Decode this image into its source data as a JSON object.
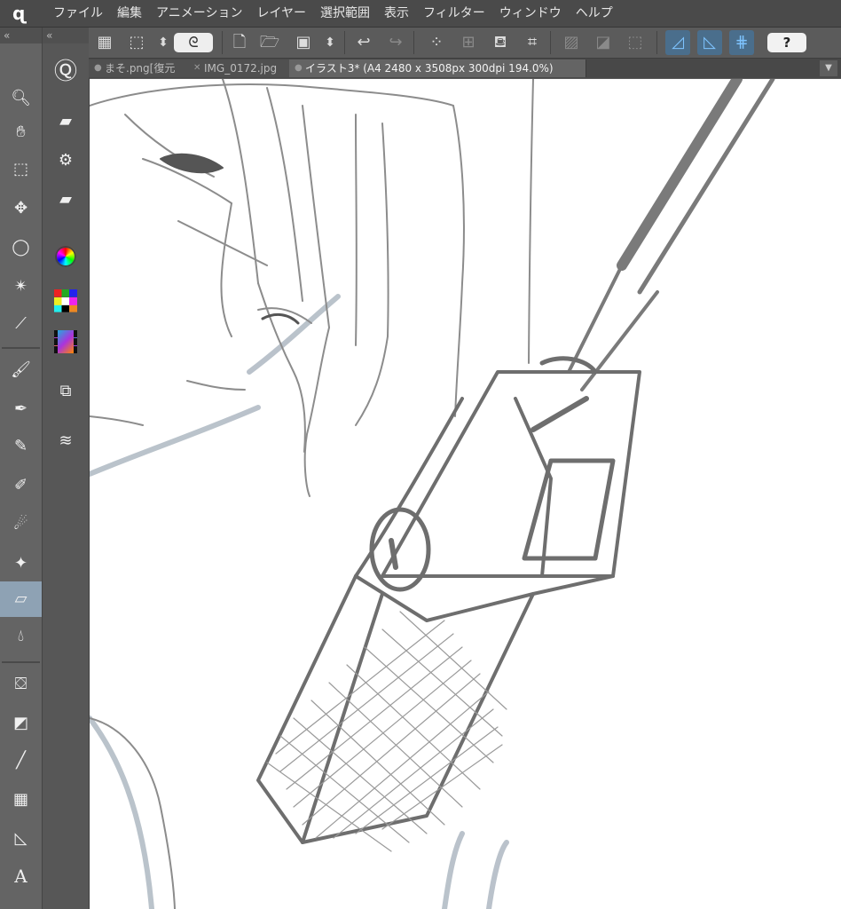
{
  "app": {
    "logo_glyph": "ɋ"
  },
  "menu": [
    "ファイル",
    "編集",
    "アニメーション",
    "レイヤー",
    "選択範囲",
    "表示",
    "フィルター",
    "ウィンドウ",
    "ヘルプ"
  ],
  "toolbar": {
    "icons": [
      "grid-icon",
      "selection-icon",
      "up-down-stepper-icon",
      "lasso-icon",
      "new-file-icon",
      "open-file-icon",
      "save-icon",
      "up-down-stepper-icon",
      "undo-icon",
      "redo-icon",
      "sparkle-icon",
      "transform-icon",
      "fill-icon",
      "crop-icon",
      "clear-icon",
      "invert-icon",
      "select-all-icon",
      "ruler-snap-icon",
      "special-ruler-snap-icon",
      "grid-snap-icon"
    ],
    "help_label": "?"
  },
  "tabs": [
    {
      "label": "まそ.png[復元",
      "active": false,
      "mark": "●"
    },
    {
      "label": "IMG_0172.jpg",
      "active": false,
      "mark": "✕"
    },
    {
      "label": "イラスト3* (A4 2480 x 3508px 300dpi 194.0%)",
      "active": true,
      "mark": "●"
    }
  ],
  "tool_panel": {
    "collapse_label": "«",
    "tools": [
      "zoom-icon",
      "hand-icon",
      "object-icon",
      "operation-icon",
      "lasso-selection-icon",
      "magic-wand-icon",
      "eyedropper-icon",
      "brush-icon",
      "pen-icon",
      "pencil-icon",
      "marker-icon",
      "airbrush-icon",
      "decoration-icon",
      "eraser-icon",
      "blend-icon",
      "fill-bucket-icon",
      "gradient-icon",
      "line-icon",
      "frame-icon",
      "ruler-icon",
      "text-icon"
    ],
    "selected": "eraser-icon",
    "text_tool_glyph": "A"
  },
  "sub_panel": {
    "collapse_label": "«",
    "items": [
      "quick-access-icon",
      "tool-property-icon",
      "sub-tool-detail-icon",
      "tool-settings-icon",
      "color-wheel-icon",
      "color-set-icon",
      "animation-timeline-icon",
      "layer-property-icon",
      "layer-icon"
    ]
  },
  "colors": {
    "menubar": "#4a4a4a",
    "panel": "#646464",
    "accent": "#7ec4ff",
    "selected_tool": "#8ea2b4",
    "canvas": "#ffffff"
  }
}
